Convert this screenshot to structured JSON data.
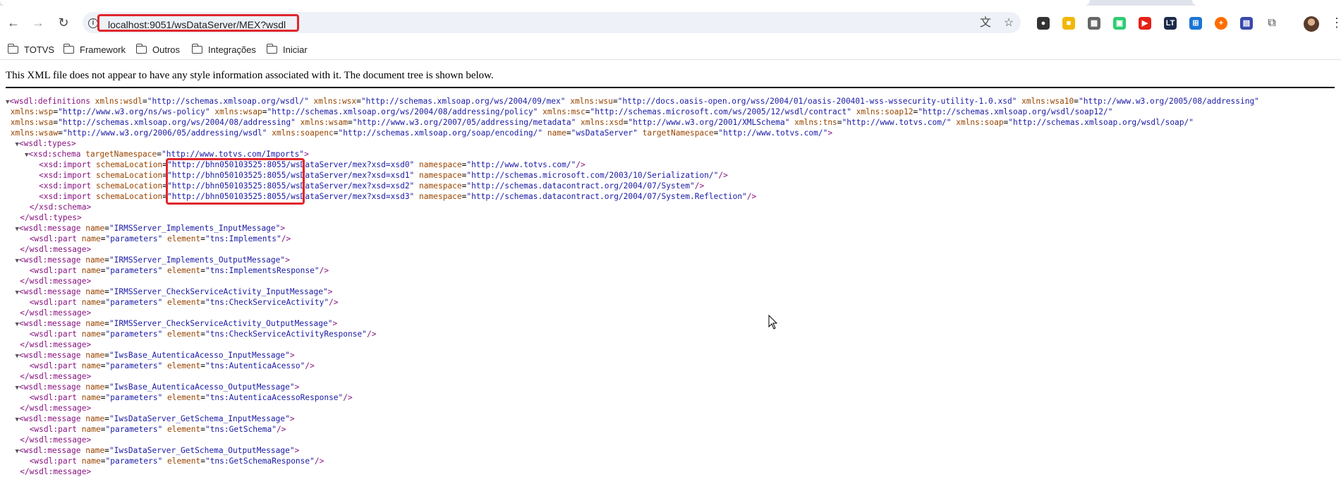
{
  "browser": {
    "url": "localhost:9051/wsDataServer/MEX?wsdl",
    "bookmarks": [
      "TOTVS",
      "Framework",
      "Outros",
      "Integrações",
      "Iniciar"
    ]
  },
  "page": {
    "info": "This XML file does not appear to have any style information associated with it. The document tree is shown below."
  },
  "xml": [
    "▼<wsdl:definitions xmlns:wsdl=\"http://schemas.xmlsoap.org/wsdl/\" xmlns:wsx=\"http://schemas.xmlsoap.org/ws/2004/09/mex\" xmlns:wsu=\"http://docs.oasis-open.org/wss/2004/01/oasis-200401-wss-wssecurity-utility-1.0.xsd\" xmlns:wsa10=\"http://www.w3.org/2005/08/addressing\"",
    " xmlns:wsp=\"http://www.w3.org/ns/ws-policy\" xmlns:wsap=\"http://schemas.xmlsoap.org/ws/2004/08/addressing/policy\" xmlns:msc=\"http://schemas.microsoft.com/ws/2005/12/wsdl/contract\" xmlns:soap12=\"http://schemas.xmlsoap.org/wsdl/soap12/\"",
    " xmlns:wsa=\"http://schemas.xmlsoap.org/ws/2004/08/addressing\" xmlns:wsam=\"http://www.w3.org/2007/05/addressing/metadata\" xmlns:xsd=\"http://www.w3.org/2001/XMLSchema\" xmlns:tns=\"http://www.totvs.com/\" xmlns:soap=\"http://schemas.xmlsoap.org/wsdl/soap/\"",
    " xmlns:wsaw=\"http://www.w3.org/2006/05/addressing/wsdl\" xmlns:soapenc=\"http://schemas.xmlsoap.org/soap/encoding/\" name=\"wsDataServer\" targetNamespace=\"http://www.totvs.com/\">",
    "  ▼<wsdl:types>",
    "    ▼<xsd:schema targetNamespace=\"http://www.totvs.com/Imports\">",
    "       <xsd:import schemaLocation=\"http://bhn050103525:8055/wsDataServer/mex?xsd=xsd0\" namespace=\"http://www.totvs.com/\"/>",
    "       <xsd:import schemaLocation=\"http://bhn050103525:8055/wsDataServer/mex?xsd=xsd1\" namespace=\"http://schemas.microsoft.com/2003/10/Serialization/\"/>",
    "       <xsd:import schemaLocation=\"http://bhn050103525:8055/wsDataServer/mex?xsd=xsd2\" namespace=\"http://schemas.datacontract.org/2004/07/System\"/>",
    "       <xsd:import schemaLocation=\"http://bhn050103525:8055/wsDataServer/mex?xsd=xsd3\" namespace=\"http://schemas.datacontract.org/2004/07/System.Reflection\"/>",
    "     </xsd:schema>",
    "   </wsdl:types>",
    "  ▼<wsdl:message name=\"IRMSServer_Implements_InputMessage\">",
    "     <wsdl:part name=\"parameters\" element=\"tns:Implements\"/>",
    "   </wsdl:message>",
    "  ▼<wsdl:message name=\"IRMSServer_Implements_OutputMessage\">",
    "     <wsdl:part name=\"parameters\" element=\"tns:ImplementsResponse\"/>",
    "   </wsdl:message>",
    "  ▼<wsdl:message name=\"IRMSServer_CheckServiceActivity_InputMessage\">",
    "     <wsdl:part name=\"parameters\" element=\"tns:CheckServiceActivity\"/>",
    "   </wsdl:message>",
    "  ▼<wsdl:message name=\"IRMSServer_CheckServiceActivity_OutputMessage\">",
    "     <wsdl:part name=\"parameters\" element=\"tns:CheckServiceActivityResponse\"/>",
    "   </wsdl:message>",
    "  ▼<wsdl:message name=\"IwsBase_AutenticaAcesso_InputMessage\">",
    "     <wsdl:part name=\"parameters\" element=\"tns:AutenticaAcesso\"/>",
    "   </wsdl:message>",
    "  ▼<wsdl:message name=\"IwsBase_AutenticaAcesso_OutputMessage\">",
    "     <wsdl:part name=\"parameters\" element=\"tns:AutenticaAcessoResponse\"/>",
    "   </wsdl:message>",
    "  ▼<wsdl:message name=\"IwsDataServer_GetSchema_InputMessage\">",
    "     <wsdl:part name=\"parameters\" element=\"tns:GetSchema\"/>",
    "   </wsdl:message>",
    "  ▼<wsdl:message name=\"IwsDataServer_GetSchema_OutputMessage\">",
    "     <wsdl:part name=\"parameters\" element=\"tns:GetSchemaResponse\"/>",
    "   </wsdl:message>"
  ]
}
